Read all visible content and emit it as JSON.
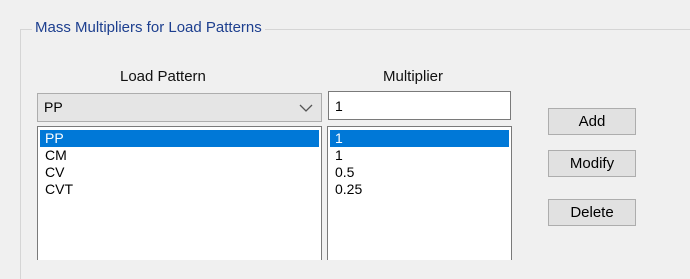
{
  "group": {
    "title": "Mass Multipliers for Load Patterns"
  },
  "headers": {
    "load_pattern": "Load Pattern",
    "multiplier": "Multiplier"
  },
  "combo": {
    "selected": "PP",
    "icon": "chevron-down-icon"
  },
  "multiplier_input": {
    "value": "1"
  },
  "load_pattern_list": [
    {
      "label": "PP",
      "selected": true
    },
    {
      "label": "CM",
      "selected": false
    },
    {
      "label": "CV",
      "selected": false
    },
    {
      "label": "CVT",
      "selected": false
    }
  ],
  "multiplier_list": [
    {
      "label": "1",
      "selected": true
    },
    {
      "label": "1",
      "selected": false
    },
    {
      "label": "0.5",
      "selected": false
    },
    {
      "label": "0.25",
      "selected": false
    }
  ],
  "buttons": {
    "add": "Add",
    "modify": "Modify",
    "delete": "Delete"
  },
  "colors": {
    "selection": "#0078d7",
    "group_title": "#1d3f8f"
  }
}
